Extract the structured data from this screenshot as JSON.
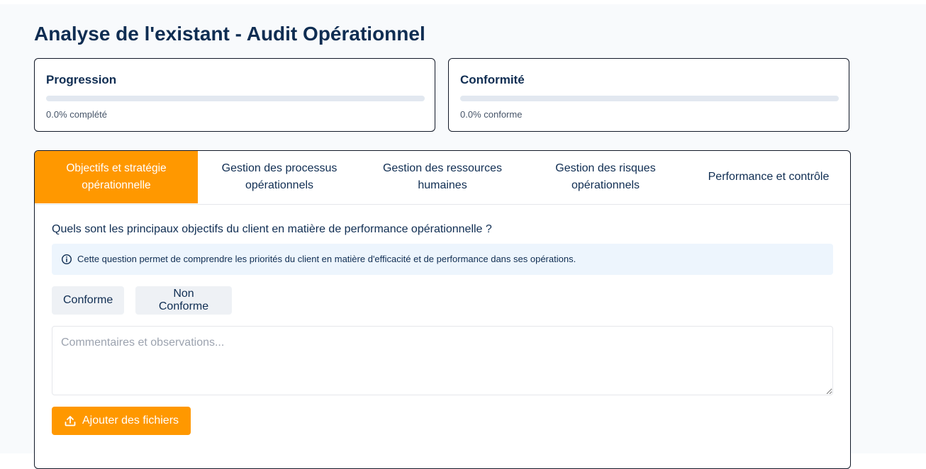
{
  "page": {
    "title": "Analyse de l'existant - Audit Opérationnel"
  },
  "stats": {
    "progression": {
      "title": "Progression",
      "value": 0.0,
      "text": "0.0% complété"
    },
    "conformite": {
      "title": "Conformité",
      "value": 0.0,
      "text": "0.0% conforme"
    }
  },
  "tabs": [
    {
      "label": "Objectifs et stratégie opérationnelle",
      "active": true
    },
    {
      "label": "Gestion des processus opérationnels",
      "active": false
    },
    {
      "label": "Gestion des ressources humaines",
      "active": false
    },
    {
      "label": "Gestion des risques opérationnels",
      "active": false
    },
    {
      "label": "Performance et contrôle",
      "active": false
    }
  ],
  "question": {
    "text": "Quels sont les principaux objectifs du client en matière de performance opérationnelle ?",
    "info": "Cette question permet de comprendre les priorités du client en matière d'efficacité et de performance dans ses opérations.",
    "info_icon": "info-circle-icon"
  },
  "options": {
    "conforme": "Conforme",
    "non_conforme": "Non Conforme"
  },
  "comment": {
    "placeholder": "Commentaires et observations...",
    "value": ""
  },
  "upload": {
    "label": "Ajouter des fichiers",
    "icon": "upload-icon"
  },
  "colors": {
    "accent": "#ff9800",
    "title": "#0f2d52",
    "info_bg": "#edf5fd",
    "track": "#e2e8f0"
  }
}
